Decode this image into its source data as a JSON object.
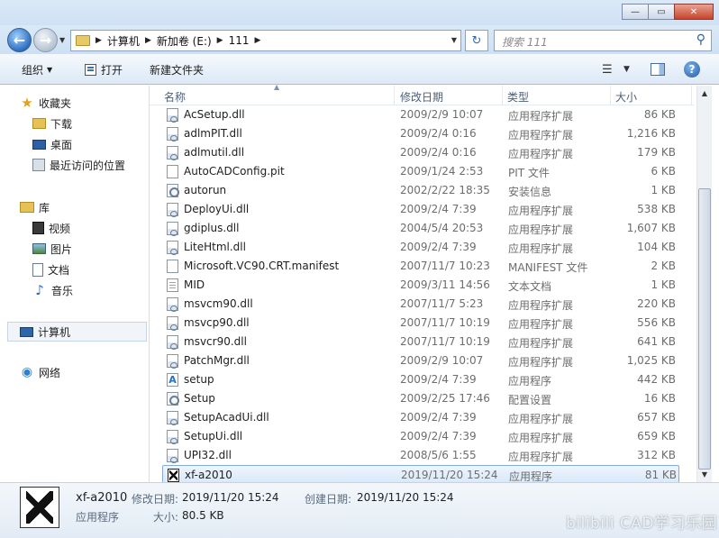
{
  "window": {
    "minimize_glyph": "—",
    "maximize_glyph": "▭",
    "close_glyph": "✕"
  },
  "nav": {
    "breadcrumb": [
      "计算机",
      "新加卷 (E:)",
      "111"
    ],
    "search_placeholder": "搜索 111"
  },
  "toolbar": {
    "organize_label": "组织",
    "open_label": "打开",
    "new_folder_label": "新建文件夹"
  },
  "sidebar": {
    "favorites_label": "收藏夹",
    "downloads_label": "下载",
    "desktop_label": "桌面",
    "recent_label": "最近访问的位置",
    "libraries_label": "库",
    "videos_label": "视频",
    "pictures_label": "图片",
    "documents_label": "文档",
    "music_label": "音乐",
    "computer_label": "计算机",
    "network_label": "网络"
  },
  "columns": {
    "name": "名称",
    "date": "修改日期",
    "type": "类型",
    "size": "大小"
  },
  "files": [
    {
      "name": "AcSetup.dll",
      "date": "2009/2/9 10:07",
      "type": "应用程序扩展",
      "size": "86 KB",
      "icon": "dll-icon"
    },
    {
      "name": "adlmPIT.dll",
      "date": "2009/2/4 0:16",
      "type": "应用程序扩展",
      "size": "1,216 KB",
      "icon": "dll-icon"
    },
    {
      "name": "adlmutil.dll",
      "date": "2009/2/4 0:16",
      "type": "应用程序扩展",
      "size": "179 KB",
      "icon": "dll-icon"
    },
    {
      "name": "AutoCADConfig.pit",
      "date": "2009/1/24 2:53",
      "type": "PIT 文件",
      "size": "6 KB",
      "icon": "blank-file-icon"
    },
    {
      "name": "autorun",
      "date": "2002/2/22 18:35",
      "type": "安装信息",
      "size": "1 KB",
      "icon": "setup-info-icon"
    },
    {
      "name": "DeployUi.dll",
      "date": "2009/2/4 7:39",
      "type": "应用程序扩展",
      "size": "538 KB",
      "icon": "dll-icon"
    },
    {
      "name": "gdiplus.dll",
      "date": "2004/5/4 20:53",
      "type": "应用程序扩展",
      "size": "1,607 KB",
      "icon": "dll-icon"
    },
    {
      "name": "LiteHtml.dll",
      "date": "2009/2/4 7:39",
      "type": "应用程序扩展",
      "size": "104 KB",
      "icon": "dll-icon"
    },
    {
      "name": "Microsoft.VC90.CRT.manifest",
      "date": "2007/11/7 10:23",
      "type": "MANIFEST 文件",
      "size": "2 KB",
      "icon": "blank-file-icon"
    },
    {
      "name": "MID",
      "date": "2009/3/11 14:56",
      "type": "文本文档",
      "size": "1 KB",
      "icon": "text-file-icon"
    },
    {
      "name": "msvcm90.dll",
      "date": "2007/11/7 5:23",
      "type": "应用程序扩展",
      "size": "220 KB",
      "icon": "dll-icon"
    },
    {
      "name": "msvcp90.dll",
      "date": "2007/11/7 10:19",
      "type": "应用程序扩展",
      "size": "556 KB",
      "icon": "dll-icon"
    },
    {
      "name": "msvcr90.dll",
      "date": "2007/11/7 10:19",
      "type": "应用程序扩展",
      "size": "641 KB",
      "icon": "dll-icon"
    },
    {
      "name": "PatchMgr.dll",
      "date": "2009/2/9 10:07",
      "type": "应用程序扩展",
      "size": "1,025 KB",
      "icon": "dll-icon"
    },
    {
      "name": "setup",
      "date": "2009/2/4 7:39",
      "type": "应用程序",
      "size": "442 KB",
      "icon": "setup-app-icon"
    },
    {
      "name": "Setup",
      "date": "2009/2/25 17:46",
      "type": "配置设置",
      "size": "16 KB",
      "icon": "setup-info-icon"
    },
    {
      "name": "SetupAcadUi.dll",
      "date": "2009/2/4 7:39",
      "type": "应用程序扩展",
      "size": "657 KB",
      "icon": "dll-icon"
    },
    {
      "name": "SetupUi.dll",
      "date": "2009/2/4 7:39",
      "type": "应用程序扩展",
      "size": "659 KB",
      "icon": "dll-icon"
    },
    {
      "name": "UPI32.dll",
      "date": "2008/5/6 1:55",
      "type": "应用程序扩展",
      "size": "312 KB",
      "icon": "dll-icon"
    },
    {
      "name": "xf-a2010",
      "date": "2019/11/20 15:24",
      "type": "应用程序",
      "size": "81 KB",
      "icon": "xf-app-icon",
      "selected": true
    }
  ],
  "details": {
    "name": "xf-a2010",
    "modified_label": "修改日期:",
    "modified_value": "2019/11/20 15:24",
    "created_label": "创建日期:",
    "created_value": "2019/11/20 15:24",
    "type_value": "应用程序",
    "size_label": "大小:",
    "size_value": "80.5 KB"
  },
  "watermark": "bilibili CAD学习乐园"
}
